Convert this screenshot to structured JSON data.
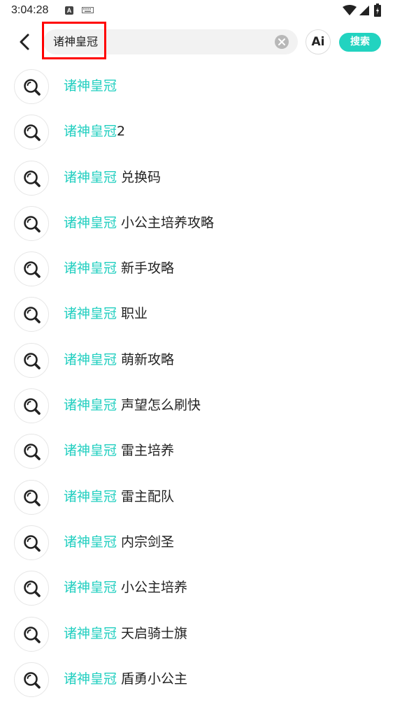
{
  "status_bar": {
    "time": "3:04:28",
    "notification_icon_letter": "A",
    "icons": [
      "a-notification-icon",
      "keyboard-icon",
      "wifi-icon",
      "cell-signal-icon",
      "battery-charging-icon"
    ]
  },
  "header": {
    "back_icon": "chevron-left-icon",
    "search_value": "诸神皇冠",
    "clear_icon": "clear-circle-icon",
    "ai_label": "Ai",
    "search_label": "搜索"
  },
  "colors": {
    "accent": "#22d3c0",
    "highlight_box": "#ff0000"
  },
  "suggestions": [
    {
      "keyword": "诸神皇冠",
      "rest": ""
    },
    {
      "keyword": "诸神皇冠",
      "rest": "2"
    },
    {
      "keyword": "诸神皇冠",
      "rest": " 兑换码"
    },
    {
      "keyword": "诸神皇冠",
      "rest": " 小公主培养攻略"
    },
    {
      "keyword": "诸神皇冠",
      "rest": " 新手攻略"
    },
    {
      "keyword": "诸神皇冠",
      "rest": " 职业"
    },
    {
      "keyword": "诸神皇冠",
      "rest": " 萌新攻略"
    },
    {
      "keyword": "诸神皇冠",
      "rest": " 声望怎么刷快"
    },
    {
      "keyword": "诸神皇冠",
      "rest": " 雷主培养"
    },
    {
      "keyword": "诸神皇冠",
      "rest": " 雷主配队"
    },
    {
      "keyword": "诸神皇冠",
      "rest": " 内宗剑圣"
    },
    {
      "keyword": "诸神皇冠",
      "rest": " 小公主培养"
    },
    {
      "keyword": "诸神皇冠",
      "rest": " 天启骑士旗"
    },
    {
      "keyword": "诸神皇冠",
      "rest": " 盾勇小公主"
    }
  ]
}
